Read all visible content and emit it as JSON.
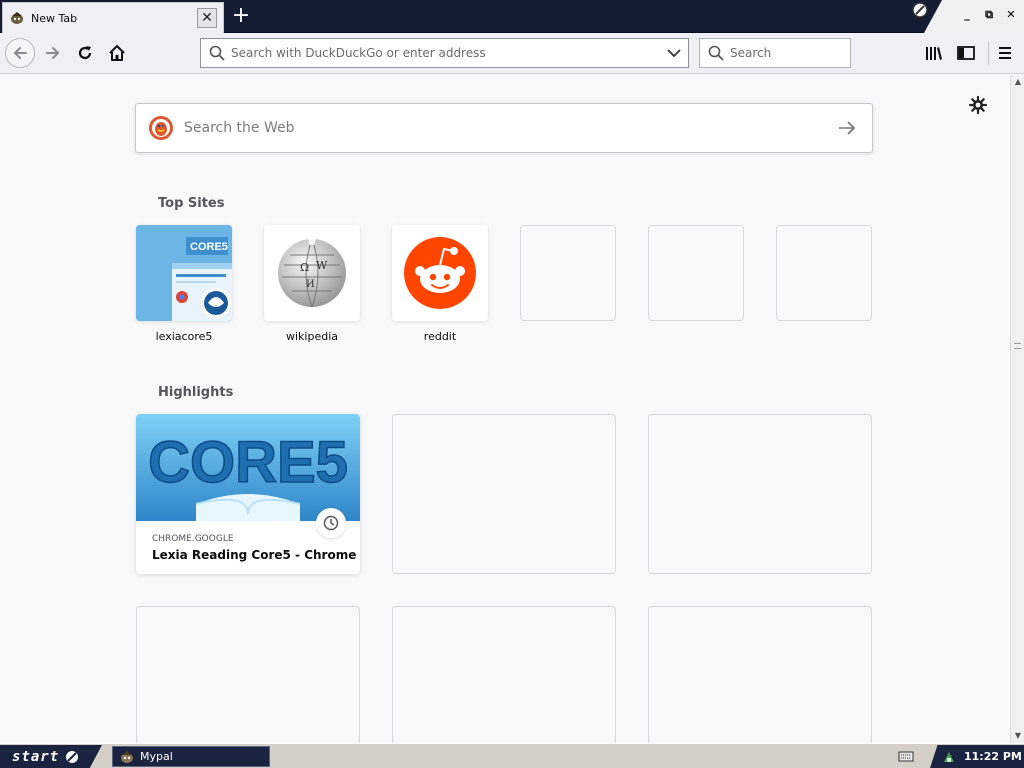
{
  "window": {
    "tab_title": "New Tab",
    "close_symbol": "✕",
    "newtab_symbol": "+",
    "minimize_symbol": "_",
    "restore_symbol": "⧉",
    "close_window_symbol": "✕"
  },
  "toolbar": {
    "url_placeholder": "Search with DuckDuckGo or enter address",
    "search_placeholder": "Search"
  },
  "newtab": {
    "websearch_placeholder": "Search the Web",
    "top_sites_title": "Top Sites",
    "highlights_title": "Highlights",
    "top_sites": [
      {
        "label": "lexiacore5",
        "tile_text": "CORE5",
        "icon": "lexia-thumbnail"
      },
      {
        "label": "wikipedia",
        "icon": "wikipedia-globe-icon"
      },
      {
        "label": "reddit",
        "icon": "reddit-alien-icon"
      }
    ],
    "highlights": [
      {
        "host": "CHROME.GOOGLE",
        "title": "Lexia Reading Core5 - Chrome ...",
        "image_text": "CORE5"
      }
    ]
  },
  "taskbar": {
    "start_label": "start",
    "task_label": "Mypal",
    "clock": "11:22 PM"
  },
  "colors": {
    "tabstrip": "#141c33",
    "reddit": "#ff4500",
    "ddg": "#de5833",
    "lexia_blue": "#6cb6e6",
    "taskbar_dark": "#1a2440"
  }
}
